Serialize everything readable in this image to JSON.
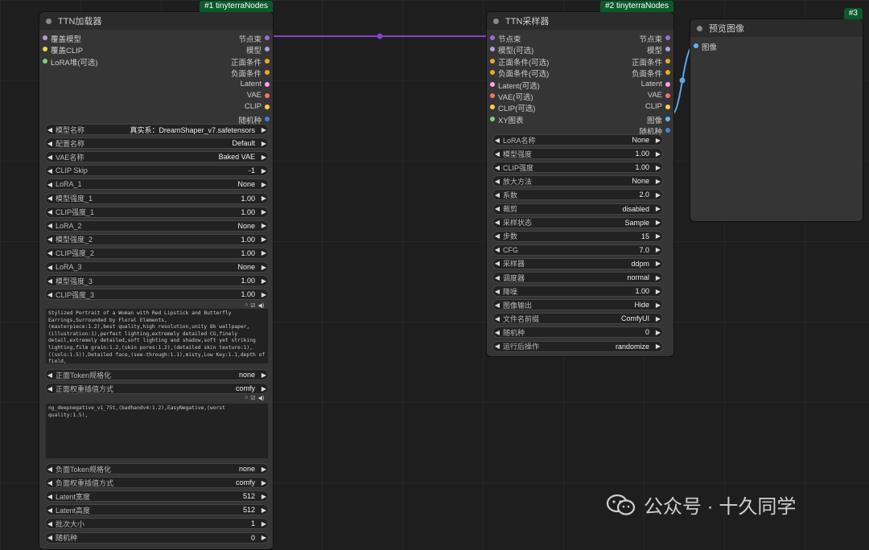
{
  "canvas": {
    "background": "#1e1e1e",
    "grid_color": "#262626"
  },
  "colors": {
    "link_purple": "#8b3fd1",
    "link_blue": "#5aa6e8",
    "slot_model": "#b39ddb",
    "slot_clip": "#f5d142",
    "slot_lora": "#7dd37d",
    "slot_cond": "#f5a623",
    "slot_latent": "#ff9cf9",
    "slot_vae": "#ff6e6e",
    "slot_image": "#64b5f6",
    "slot_seed": "#4a7fd4",
    "slot_pipe": "#9b6bd8",
    "badge_bg": "#0a5a2a"
  },
  "loader": {
    "badge": "#1 tinyterraNodes",
    "title": "TTN加载器",
    "inputs": [
      {
        "label": "覆盖模型",
        "color": "#b39ddb"
      },
      {
        "label": "覆盖CLIP",
        "color": "#f5d142"
      },
      {
        "label": "LoRA堆(可选)",
        "color": "#7dd37d"
      }
    ],
    "outputs": [
      {
        "label": "节点束",
        "color": "#9b6bd8"
      },
      {
        "label": "模型",
        "color": "#b39ddb"
      },
      {
        "label": "正面条件",
        "color": "#f5a623"
      },
      {
        "label": "负面条件",
        "color": "#f5a623"
      },
      {
        "label": "Latent",
        "color": "#ff9cf9"
      },
      {
        "label": "VAE",
        "color": "#ff6e6e"
      },
      {
        "label": "CLIP",
        "color": "#f5d142"
      },
      {
        "label": "随机种",
        "color": "#4a7fd4"
      }
    ],
    "widgets_top": [
      {
        "label": "模型名称",
        "value": "真实系：DreamShaper_v7.safetensors"
      },
      {
        "label": "配置名称",
        "value": "Default"
      },
      {
        "label": "VAE名称",
        "value": "Baked VAE"
      },
      {
        "label": "CLIP Skip",
        "value": "-1"
      },
      {
        "label": "LoRA_1",
        "value": "None"
      },
      {
        "label": "模型强度_1",
        "value": "1.00"
      },
      {
        "label": "CLIP强度_1",
        "value": "1.00"
      },
      {
        "label": "LoRA_2",
        "value": "None"
      },
      {
        "label": "模型强度_2",
        "value": "1.00"
      },
      {
        "label": "CLIP强度_2",
        "value": "1.00"
      },
      {
        "label": "LoRA_3",
        "value": "None"
      },
      {
        "label": "模型强度_3",
        "value": "1.00"
      },
      {
        "label": "CLIP强度_3",
        "value": "1.00"
      }
    ],
    "positive_prompt": "Stylized Portrait of a Woman with Red Lipstick and Butterfly Earrings,Surrounded by Floral Elements,\n(masterpiece:1.2),best quality,high resolution,unity 8k wallpaper,(illustration:1),perfect lighting,extremely detailed CG,finely detail,extremely detailed,soft lighting and shadow,soft yet striking lighting,film grain:1.2,(skin pores:1.2),(detailed skin texture:1),((solo:1.5)),Detailed face,(see-through:1.1),misty,Low Key:1.1,depth of field,",
    "widgets_mid": [
      {
        "label": "正面Token规格化",
        "value": "none"
      },
      {
        "label": "正面权重插值方式",
        "value": "comfy"
      }
    ],
    "negative_prompt": "ng_deepnegative_v1_75t,(badhandv4:1.2),EasyNegative,(worst quality:1.5),",
    "widgets_bottom": [
      {
        "label": "负面Token规格化",
        "value": "none"
      },
      {
        "label": "负面权重插值方式",
        "value": "comfy"
      },
      {
        "label": "Latent宽度",
        "value": "512"
      },
      {
        "label": "Latent高度",
        "value": "512"
      },
      {
        "label": "批次大小",
        "value": "1"
      },
      {
        "label": "随机种",
        "value": "0"
      }
    ]
  },
  "sampler": {
    "badge": "#2 tinyterraNodes",
    "title": "TTN采样器",
    "inputs": [
      {
        "label": "节点束",
        "color": "#9b6bd8"
      },
      {
        "label": "模型(可选)",
        "color": "#b39ddb"
      },
      {
        "label": "正面条件(可选)",
        "color": "#f5a623"
      },
      {
        "label": "负面条件(可选)",
        "color": "#f5a623"
      },
      {
        "label": "Latent(可选)",
        "color": "#ff9cf9"
      },
      {
        "label": "VAE(可选)",
        "color": "#ff6e6e"
      },
      {
        "label": "CLIP(可选)",
        "color": "#f5d142"
      },
      {
        "label": "XY图表",
        "color": "#7dd37d"
      }
    ],
    "outputs": [
      {
        "label": "节点束",
        "color": "#9b6bd8"
      },
      {
        "label": "模型",
        "color": "#b39ddb"
      },
      {
        "label": "正面条件",
        "color": "#f5a623"
      },
      {
        "label": "负面条件",
        "color": "#f5a623"
      },
      {
        "label": "Latent",
        "color": "#ff9cf9"
      },
      {
        "label": "VAE",
        "color": "#ff6e6e"
      },
      {
        "label": "CLIP",
        "color": "#f5d142"
      },
      {
        "label": "图像",
        "color": "#64b5f6"
      },
      {
        "label": "随机种",
        "color": "#4a7fd4"
      }
    ],
    "widgets": [
      {
        "label": "LoRA名称",
        "value": "None"
      },
      {
        "label": "模型强度",
        "value": "1.00"
      },
      {
        "label": "CLIP强度",
        "value": "1.00"
      },
      {
        "label": "放大方法",
        "value": "None"
      },
      {
        "label": "系数",
        "value": "2.0"
      },
      {
        "label": "裁剪",
        "value": "disabled"
      },
      {
        "label": "采样状态",
        "value": "Sample"
      },
      {
        "label": "步数",
        "value": "15"
      },
      {
        "label": "CFG",
        "value": "7.0"
      },
      {
        "label": "采样器",
        "value": "ddpm"
      },
      {
        "label": "调度器",
        "value": "normal"
      },
      {
        "label": "降噪",
        "value": "1.00"
      },
      {
        "label": "图像输出",
        "value": "Hide"
      },
      {
        "label": "文件名前缀",
        "value": "ComfyUI"
      },
      {
        "label": "随机种",
        "value": "0"
      },
      {
        "label": "运行后操作",
        "value": "randomize"
      }
    ]
  },
  "preview": {
    "badge": "#3",
    "title": "预览图像",
    "input": {
      "label": "图像",
      "color": "#64b5f6"
    }
  },
  "watermark": {
    "text": "公众号 · 十久同学"
  }
}
